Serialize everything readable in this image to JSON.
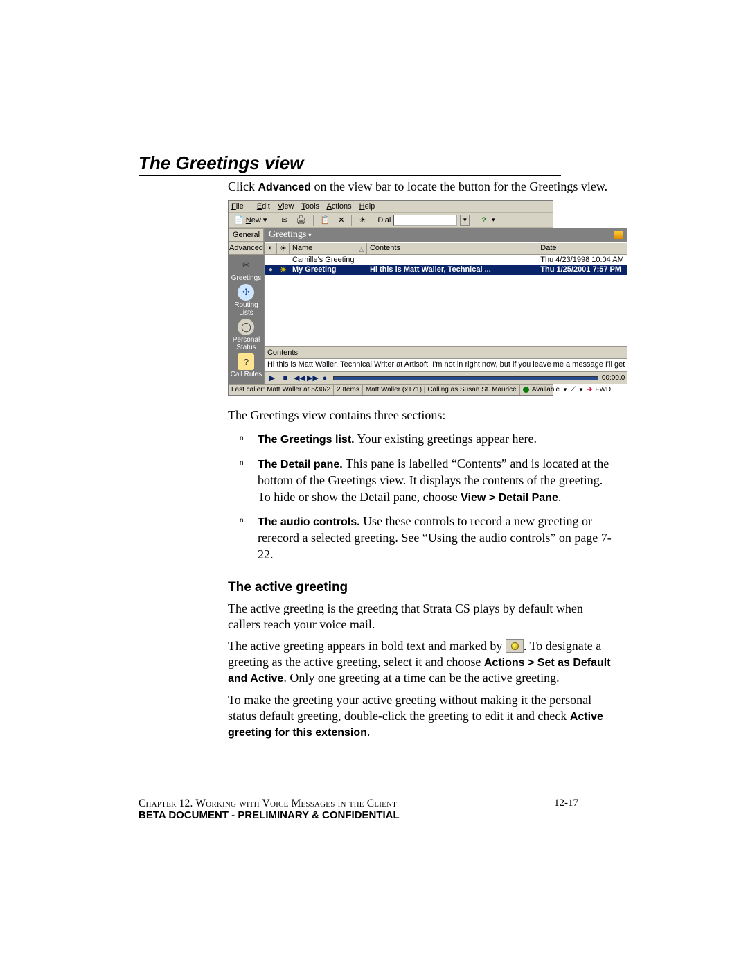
{
  "heading": "The Greetings view",
  "intro_pre": "Click ",
  "intro_bold": "Advanced",
  "intro_post": " on the view bar to locate the button for the Greetings view.",
  "screenshot": {
    "menus": [
      "File",
      "Edit",
      "View",
      "Tools",
      "Actions",
      "Help"
    ],
    "toolbar": {
      "new_label": "New",
      "dial_label": "Dial"
    },
    "nav_tabs": [
      "General",
      "Advanced"
    ],
    "nav_items": [
      {
        "label": "Greetings"
      },
      {
        "label": "Routing Lists"
      },
      {
        "label": "Personal Status"
      },
      {
        "label": "Call Rules"
      }
    ],
    "view_title": "Greetings",
    "columns": {
      "name": "Name",
      "contents": "Contents",
      "date": "Date"
    },
    "rows": [
      {
        "name": "Camille's Greeting",
        "contents": "",
        "date": "Thu 4/23/1998 10:04 AM",
        "active": false
      },
      {
        "name": "My Greeting",
        "contents": "Hi this is Matt Waller, Technical ...",
        "date": "Thu 1/25/2001 7:57 PM",
        "active": true
      }
    ],
    "detail_label": "Contents",
    "detail_text": "Hi this is Matt Waller, Technical Writer at Artisoft.  I'm not in right now, but if you leave me a message I'll get",
    "audio_time": "00:00.0",
    "status": {
      "last_caller": "Last caller: Matt Waller at 5/30/2",
      "items": "2 Items",
      "identity": "Matt Waller (x171) | Calling as Susan St. Maurice",
      "presence": "Available",
      "fwd": "FWD"
    }
  },
  "sections_intro": "The Greetings view contains three sections:",
  "bullets": [
    {
      "lead": "The Greetings list.",
      "rest": " Your existing greetings appear here."
    },
    {
      "lead": "The Detail pane.",
      "rest": " This pane is labelled “Contents” and is located at the bottom of the Greetings view. It displays the contents of the greeting. To hide or show the Detail pane, choose ",
      "menu_path": "View > Detail Pane",
      "tail": "."
    },
    {
      "lead": "The audio controls.",
      "rest": " Use these controls to record a new greeting or rerecord a selected greeting. See “Using the audio controls” on page 7-22."
    }
  ],
  "subheading": "The active greeting",
  "para1": "The active greeting is the greeting that Strata CS plays by default when callers reach your voice mail.",
  "para2_pre": "The active greeting appears in bold text and marked by ",
  "para2_post1": ". To designate a greeting as the active greeting, select it and choose ",
  "para2_action": "Actions > Set as Default and Active",
  "para2_post2": ". Only one greeting at a time can be the active greeting.",
  "para3_pre": "To make the greeting your active greeting without making it the personal status default greeting, double-click the greeting to edit it and check ",
  "para3_bold": "Active greeting for this extension",
  "para3_post": ".",
  "footer": {
    "chapter": "Chapter 12. Working with Voice Messages in the Client",
    "page": "12-17",
    "confidential": "BETA DOCUMENT - PRELIMINARY & CONFIDENTIAL"
  }
}
